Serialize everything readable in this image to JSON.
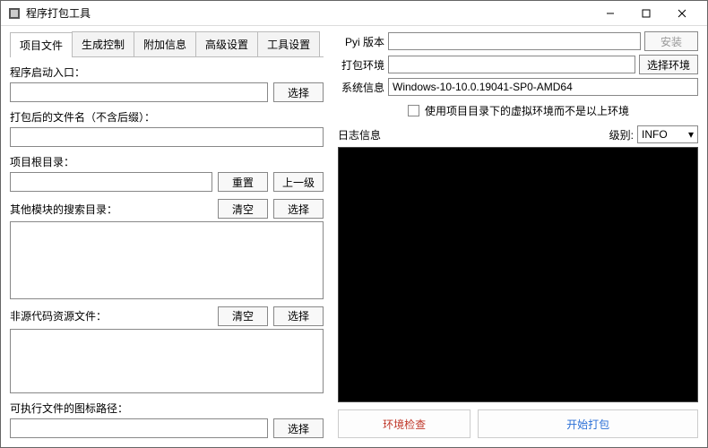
{
  "window": {
    "title": "程序打包工具"
  },
  "tabs": [
    "项目文件",
    "生成控制",
    "附加信息",
    "高级设置",
    "工具设置"
  ],
  "left": {
    "entry_label": "程序启动入口：",
    "entry_value": "",
    "entry_btn": "选择",
    "outname_label": "打包后的文件名（不含后缀）：",
    "outname_value": "",
    "projroot_label": "项目根目录：",
    "projroot_value": "",
    "projroot_reset": "重置",
    "projroot_up": "上一级",
    "searchdir_label": "其他模块的搜索目录：",
    "searchdir_value": "",
    "searchdir_clear": "清空",
    "searchdir_select": "选择",
    "resfiles_label": "非源代码资源文件：",
    "resfiles_value": "",
    "resfiles_clear": "清空",
    "resfiles_select": "选择",
    "iconpath_label": "可执行文件的图标路径：",
    "iconpath_value": "",
    "iconpath_btn": "选择"
  },
  "right": {
    "pyi_label": "Pyi 版本",
    "pyi_value": "",
    "pyi_btn": "安装",
    "env_label": "打包环境",
    "env_value": "",
    "env_btn": "选择环境",
    "sys_label": "系统信息",
    "sys_value": "Windows-10-10.0.19041-SP0-AMD64",
    "venv_chk": "使用项目目录下的虚拟环境而不是以上环境",
    "log_label": "日志信息",
    "level_label": "级别:",
    "level_value": "INFO",
    "check_btn": "环境检查",
    "start_btn": "开始打包"
  }
}
